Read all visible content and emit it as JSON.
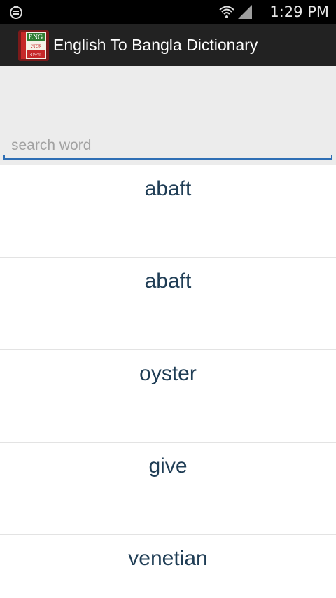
{
  "status_bar": {
    "time": "1:29 PM",
    "icons": [
      "notification-icon",
      "wifi-icon",
      "signal-icon"
    ]
  },
  "action_bar": {
    "title": "English To Bangla Dictionary",
    "logo_text_top": "ENG",
    "logo_text_mid": "থেকে",
    "logo_text_bottom": "বাংলা"
  },
  "search": {
    "placeholder": "search word",
    "value": ""
  },
  "words": [
    {
      "text": "abaft"
    },
    {
      "text": "abaft"
    },
    {
      "text": "oyster"
    },
    {
      "text": "give"
    },
    {
      "text": "venetian"
    }
  ],
  "colors": {
    "status_bar_bg": "#000000",
    "action_bar_bg": "#222222",
    "header_bg": "#ececec",
    "accent": "#2f6fb5",
    "word_text": "#1f3d55"
  }
}
